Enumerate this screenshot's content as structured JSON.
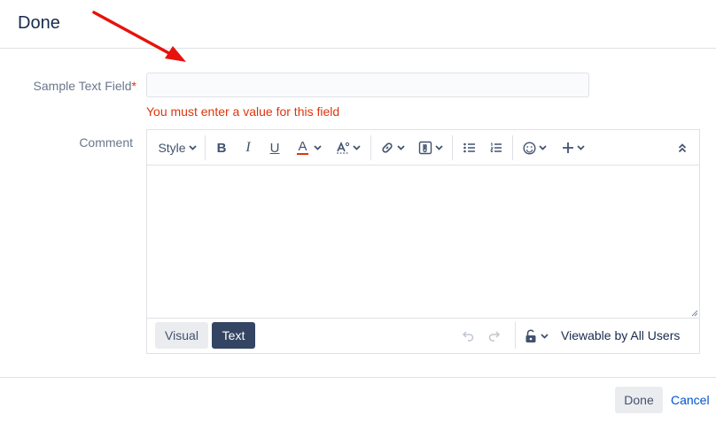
{
  "dialog": {
    "title": "Done"
  },
  "annotation": {
    "arrow_color": "#e8120c"
  },
  "form": {
    "sample_text_field": {
      "label": "Sample Text Field",
      "required_marker": "*",
      "value": "",
      "error": "You must enter a value for this field"
    },
    "comment": {
      "label": "Comment"
    }
  },
  "editor": {
    "toolbar": {
      "style_label": "Style",
      "bold": "B",
      "italic": "I",
      "underline": "U",
      "text_color": "A",
      "icons": [
        "chevron-down-icon",
        "text-format-icon",
        "link-icon",
        "attachment-icon",
        "bullet-list-icon",
        "numbered-list-icon",
        "emoji-icon",
        "plus-icon",
        "collapse-icon"
      ]
    },
    "modes": {
      "visual": "Visual",
      "text": "Text",
      "active": "Text"
    },
    "visibility": "Viewable by All Users"
  },
  "footer": {
    "done": "Done",
    "cancel": "Cancel"
  },
  "colors": {
    "error": "#de350b",
    "link": "#0052cc",
    "active_mode": "#344563"
  }
}
